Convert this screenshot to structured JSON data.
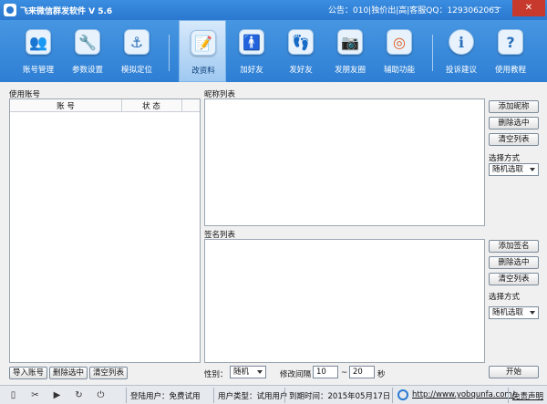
{
  "window": {
    "title": "飞来微信群发软件  V 5.6",
    "notice": "公告：010|独价出|高|客服QQ：1293062063",
    "min_glyph": "—",
    "close_glyph": "✕"
  },
  "toolbar": {
    "items": [
      {
        "label": "账号管理",
        "icon": "users-icon",
        "glyph": "👥"
      },
      {
        "label": "参数设置",
        "icon": "tools-icon",
        "glyph": "🔧"
      },
      {
        "label": "模拟定位",
        "icon": "anchor-icon",
        "glyph": "⚓"
      },
      {
        "label": "改资料",
        "icon": "profile-edit-icon",
        "glyph": "📝"
      },
      {
        "label": "加好友",
        "icon": "add-friend-icon",
        "glyph": "🚹"
      },
      {
        "label": "发好友",
        "icon": "footprint-icon",
        "glyph": "👣"
      },
      {
        "label": "发朋友圈",
        "icon": "camera-icon",
        "glyph": "📷"
      },
      {
        "label": "辅助功能",
        "icon": "ubuntu-icon",
        "glyph": "◎"
      },
      {
        "label": "投诉建议",
        "icon": "info-icon",
        "glyph": "ℹ"
      },
      {
        "label": "使用教程",
        "icon": "help-icon",
        "glyph": "?"
      }
    ],
    "active_index": 3
  },
  "accounts": {
    "title": "使用账号",
    "columns": [
      "账  号",
      "状  态"
    ],
    "import_label": "导入账号",
    "delete_label": "删除选中",
    "clear_label": "清空列表"
  },
  "nicknames": {
    "title": "昵称列表",
    "add_label": "添加昵称",
    "delete_label": "删除选中",
    "clear_label": "清空列表",
    "mode_label": "选择方式",
    "mode_value": "随机选取"
  },
  "signatures": {
    "title": "签名列表",
    "add_label": "添加签名",
    "delete_label": "删除选中",
    "clear_label": "清空列表",
    "mode_label": "选择方式",
    "mode_value": "随机选取"
  },
  "bottom": {
    "gender_label": "性别：",
    "gender_value": "随机",
    "interval_label": "修改间隔",
    "interval_from": "10",
    "interval_sep": "~",
    "interval_to": "20",
    "interval_unit": "秒",
    "start_label": "开始"
  },
  "status": {
    "login": "登陆用户：免费试用",
    "user_type": "用户类型：试用用户",
    "expire": "到期时间：2015年05月17日",
    "website": "http://www.yobqunfa.com/",
    "disclaimer": "免责声明"
  }
}
